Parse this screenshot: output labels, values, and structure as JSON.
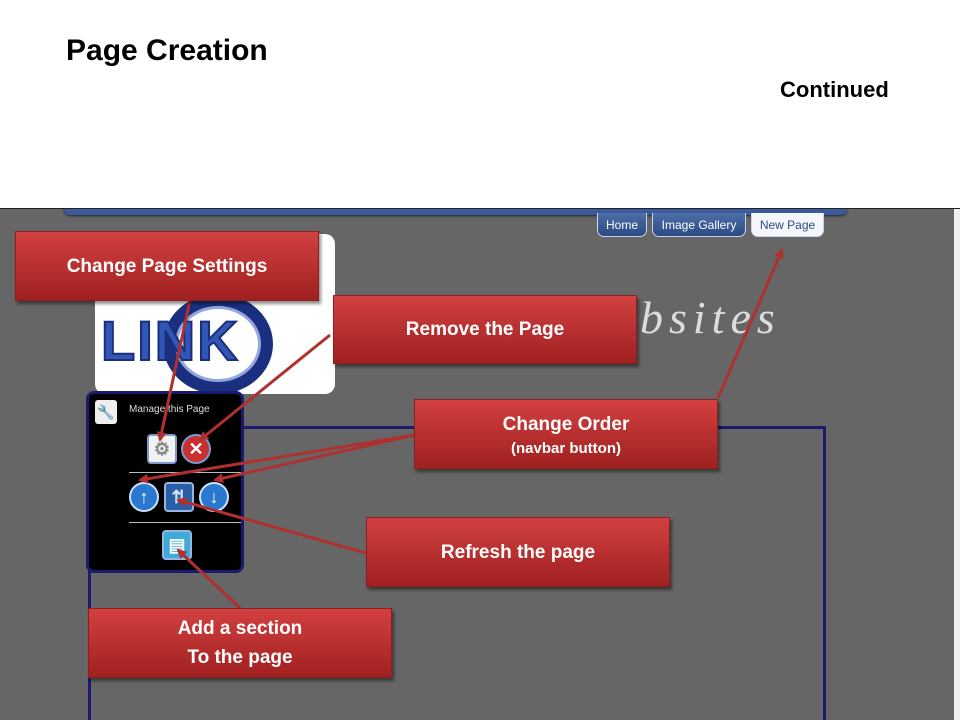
{
  "slide": {
    "title": "Page Creation",
    "subtitle": "Continued"
  },
  "navbar": {
    "tabs": [
      {
        "label": "Home"
      },
      {
        "label": "Image Gallery"
      },
      {
        "label": "New Page"
      }
    ]
  },
  "logo": {
    "text": "LINK",
    "tagline": "bsites"
  },
  "manage_panel": {
    "label": "Manage this Page",
    "icons": [
      "wrench-icon",
      "page-settings-icon",
      "remove-icon",
      "move-up-icon",
      "refresh-icon",
      "move-down-icon",
      "add-section-icon"
    ]
  },
  "callouts": {
    "settings": "Change Page Settings",
    "remove": "Remove the Page",
    "order": "Change Order",
    "order_sub": "(navbar button)",
    "refresh": "Refresh the page",
    "add_line1": "Add a section",
    "add_line2": "To the page"
  },
  "colors": {
    "callout": "#c03535",
    "arrow": "#b03030",
    "screen_bg": "#666666",
    "nav_dark": "#2c4a82"
  }
}
